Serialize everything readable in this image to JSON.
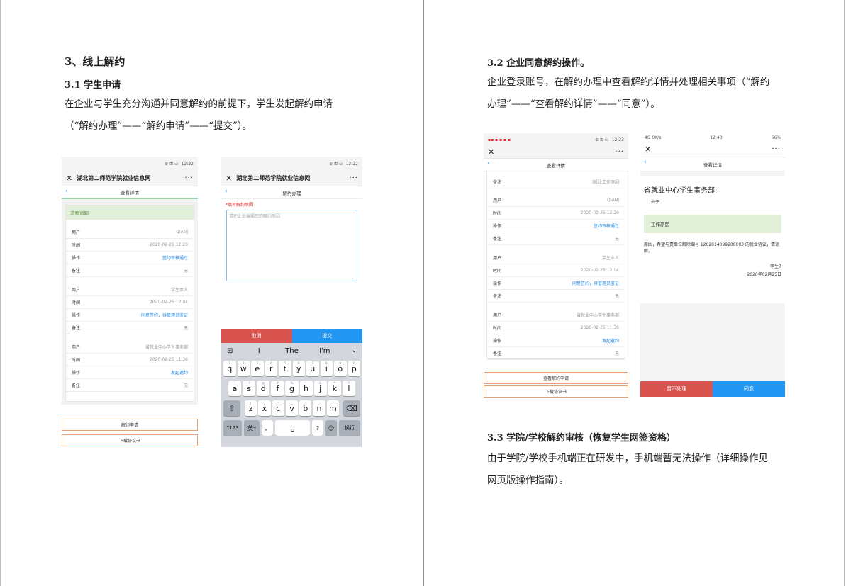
{
  "left": {
    "heading": "3、线上解约",
    "sub_heading": "3.1  学生申请",
    "para_line1": "在企业与学生充分沟通并同意解约的前提下，学生发起解约申请",
    "para_line2": "（“解约办理”——“解约申请”——“提交”）。"
  },
  "right": {
    "heading": "3.2 企业同意解约操作。",
    "para_line1": "企业登录账号，在解约办理中查看解约详情并处理相关事项（“解约",
    "para_line2": "办理”——“查看解约详情”——“同意”）。",
    "heading2": "3.3  学院/学校解约审核（恢复学生网签资格）",
    "para2_line1": "由于学院/学校手机端正在研发中，手机端暂无法操作（详细操作见",
    "para2_line2": "网页版操作指南）。"
  },
  "phone1": {
    "status_time": "12:22",
    "status_icons": "⊕ ⊞ ▭",
    "site_title": "湖北第二师范学院就业信息网",
    "nav_title": "查看详情",
    "section_title": "流程追踪",
    "groups": [
      {
        "rows": [
          {
            "k": "用户",
            "v": "QIANJ"
          },
          {
            "k": "时间",
            "v": "2020-02-25 12:20"
          },
          {
            "k": "操作",
            "v": "签约审核通过"
          },
          {
            "k": "备注",
            "v": "无"
          }
        ]
      },
      {
        "rows": [
          {
            "k": "用户",
            "v": "学生本人"
          },
          {
            "k": "时间",
            "v": "2020-02-25 12:04"
          },
          {
            "k": "操作",
            "v": "同意签约，待管理员鉴证"
          },
          {
            "k": "备注",
            "v": "无"
          }
        ]
      },
      {
        "rows": [
          {
            "k": "用户",
            "v": "省就业中心学生事务部"
          },
          {
            "k": "时间",
            "v": "2020-02-25 11:38"
          },
          {
            "k": "操作",
            "v": "发起邀约"
          },
          {
            "k": "备注",
            "v": "无"
          }
        ]
      }
    ],
    "btn_apply": "解约申请",
    "btn_download": "下载协议书"
  },
  "phone2": {
    "status_time": "12:22",
    "site_title": "湖北第二师范学院就业信息网",
    "nav_title": "解约办理",
    "field_label": "*填写解约原因",
    "placeholder": "请在此处编辑您的解约原因",
    "btn_cancel": "取消",
    "btn_submit": "提交",
    "suggestions": [
      "I",
      "The",
      "I'm"
    ],
    "row1": [
      "q",
      "w",
      "e",
      "r",
      "t",
      "y",
      "u",
      "i",
      "o",
      "p"
    ],
    "row1_small": [
      "1",
      "2",
      "3",
      "4",
      "5",
      "6",
      "7",
      "8",
      "9",
      "0"
    ],
    "row2": [
      "a",
      "s",
      "d",
      "f",
      "g",
      "h",
      "j",
      "k",
      "l"
    ],
    "row2_small": [
      "~",
      "!",
      "@",
      "#",
      "%",
      "'",
      "&",
      "*",
      "?"
    ],
    "row3": [
      "z",
      "x",
      "c",
      "v",
      "b",
      "n",
      "m"
    ],
    "row3_small": [
      "(",
      ")",
      "-",
      "_",
      ":",
      ";",
      "/"
    ],
    "key_123": "?123",
    "key_lang": "英",
    "key_lang_small": "中",
    "key_comma": "，",
    "key_q": "?",
    "key_enter": "换行"
  },
  "phone3": {
    "status_time": "12:23",
    "nav_title": "查看详情",
    "partial_row": {
      "k": "备注",
      "v": "原因:工作原因"
    },
    "groups": [
      {
        "rows": [
          {
            "k": "用户",
            "v": "QIANJ"
          },
          {
            "k": "时间",
            "v": "2020-02-25 12:20"
          },
          {
            "k": "操作",
            "v": "签约审核通过"
          },
          {
            "k": "备注",
            "v": "无"
          }
        ]
      },
      {
        "rows": [
          {
            "k": "用户",
            "v": "学生本人"
          },
          {
            "k": "时间",
            "v": "2020-02-25 12:04"
          },
          {
            "k": "操作",
            "v": "同意签约，待管理员鉴证"
          },
          {
            "k": "备注",
            "v": "无"
          }
        ]
      },
      {
        "rows": [
          {
            "k": "用户",
            "v": "省就业中心学生事务部"
          },
          {
            "k": "时间",
            "v": "2020-02-25 11:38"
          },
          {
            "k": "操作",
            "v": "发起邀约"
          },
          {
            "k": "备注",
            "v": "无"
          }
        ]
      }
    ],
    "btn_view": "查看解约申请",
    "btn_download": "下载协议书"
  },
  "phone4": {
    "status_left": "4G   0K/s",
    "status_time": "12:40",
    "status_right": "66%",
    "nav_title": "查看详情",
    "recipient": "省就业中心学生事务部:",
    "because": "由于",
    "reason": "工作原因",
    "body": "原因，希望与贵单位解除编号 1202014099200003 的就业协议，请谅解。",
    "sign_name": "学生7",
    "sign_date": "2020年02月25日",
    "btn_reject": "暂不处理",
    "btn_agree": "同意"
  }
}
